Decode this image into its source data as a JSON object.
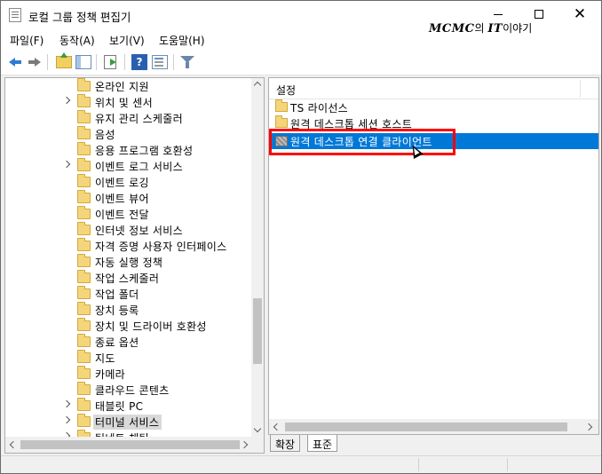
{
  "window": {
    "title": "로컬 그룹 정책 편집기",
    "watermark_brand": "MCMC",
    "watermark_mid": "의 ",
    "watermark_it": "IT",
    "watermark_tail": "이야기"
  },
  "menu": [
    {
      "label": "파일(F)"
    },
    {
      "label": "동작(A)"
    },
    {
      "label": "보기(V)"
    },
    {
      "label": "도움말(H)"
    }
  ],
  "toolbar": {
    "help_glyph": "?"
  },
  "tree": {
    "items": [
      {
        "label": "온라인 지원",
        "expandable": false
      },
      {
        "label": "위치 및 센서",
        "expandable": true
      },
      {
        "label": "유지 관리 스케줄러",
        "expandable": false
      },
      {
        "label": "음성",
        "expandable": false
      },
      {
        "label": "응용 프로그램 호환성",
        "expandable": false
      },
      {
        "label": "이벤트 로그 서비스",
        "expandable": true
      },
      {
        "label": "이벤트 로깅",
        "expandable": false
      },
      {
        "label": "이벤트 뷰어",
        "expandable": false
      },
      {
        "label": "이벤트 전달",
        "expandable": false
      },
      {
        "label": "인터넷 정보 서비스",
        "expandable": false
      },
      {
        "label": "자격 증명 사용자 인터페이스",
        "expandable": false
      },
      {
        "label": "자동 실행 정책",
        "expandable": false
      },
      {
        "label": "작업 스케줄러",
        "expandable": false
      },
      {
        "label": "작업 폴더",
        "expandable": false
      },
      {
        "label": "장치 등록",
        "expandable": false
      },
      {
        "label": "장치 및 드라이버 호환성",
        "expandable": false
      },
      {
        "label": "종료 옵션",
        "expandable": false
      },
      {
        "label": "지도",
        "expandable": false
      },
      {
        "label": "카메라",
        "expandable": false
      },
      {
        "label": "클라우드 콘텐츠",
        "expandable": false
      },
      {
        "label": "태블릿 PC",
        "expandable": true
      },
      {
        "label": "터미널 서비스",
        "expandable": true,
        "selected": true
      },
      {
        "label": "팀네트 채팅",
        "expandable": true
      }
    ]
  },
  "content": {
    "column_header": "설정",
    "items": [
      {
        "label": "TS 라이선스",
        "type": "folder"
      },
      {
        "label": "원격 데스크톱 세션 호스트",
        "type": "folder"
      },
      {
        "label": "원격 데스크톱 연결 클라이언트",
        "type": "folder",
        "selected": true
      }
    ]
  },
  "tabs": [
    {
      "label": "확장",
      "active": false
    },
    {
      "label": "표준",
      "active": true
    }
  ],
  "colors": {
    "selection": "#0078d7",
    "highlight_box": "#ff0000"
  }
}
